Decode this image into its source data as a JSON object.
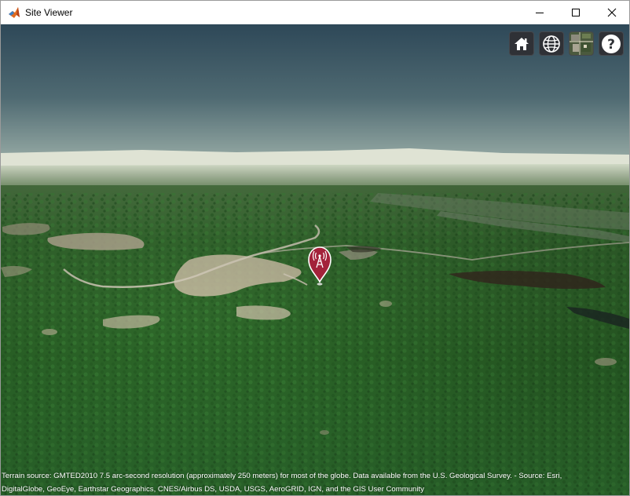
{
  "window": {
    "title": "Site Viewer",
    "icons": {
      "app": "matlab-logo-icon",
      "minimize": "minimize-icon",
      "maximize": "maximize-icon",
      "close": "close-icon"
    }
  },
  "toolbar": {
    "buttons": [
      {
        "name": "home-button",
        "icon": "home-icon"
      },
      {
        "name": "globe-view-button",
        "icon": "globe-icon"
      },
      {
        "name": "basemap-picker-button",
        "icon": "satellite-basemap-icon"
      },
      {
        "name": "help-button",
        "icon": "help-icon"
      }
    ]
  },
  "site_marker": {
    "icon": "transmitter-antenna-icon",
    "color": "#a3223a"
  },
  "credits": {
    "line1": "Terrain source: GMTED2010 7.5 arc-second resolution (approximately 250 meters) for most of the globe. Data available from the U.S. Geological Survey. - Source: Esri,",
    "line2": "DigitalGlobe, GeoEye, Earthstar Geographics, CNES/Airbus DS, USDA, USGS, AeroGRID, IGN, and the GIS User Community"
  },
  "colors": {
    "sky_top": "#2f4a5a",
    "sky_horizon": "#8fa2a0",
    "forest": "#2e6a2c",
    "toolbar_bg": "#2f3136"
  }
}
